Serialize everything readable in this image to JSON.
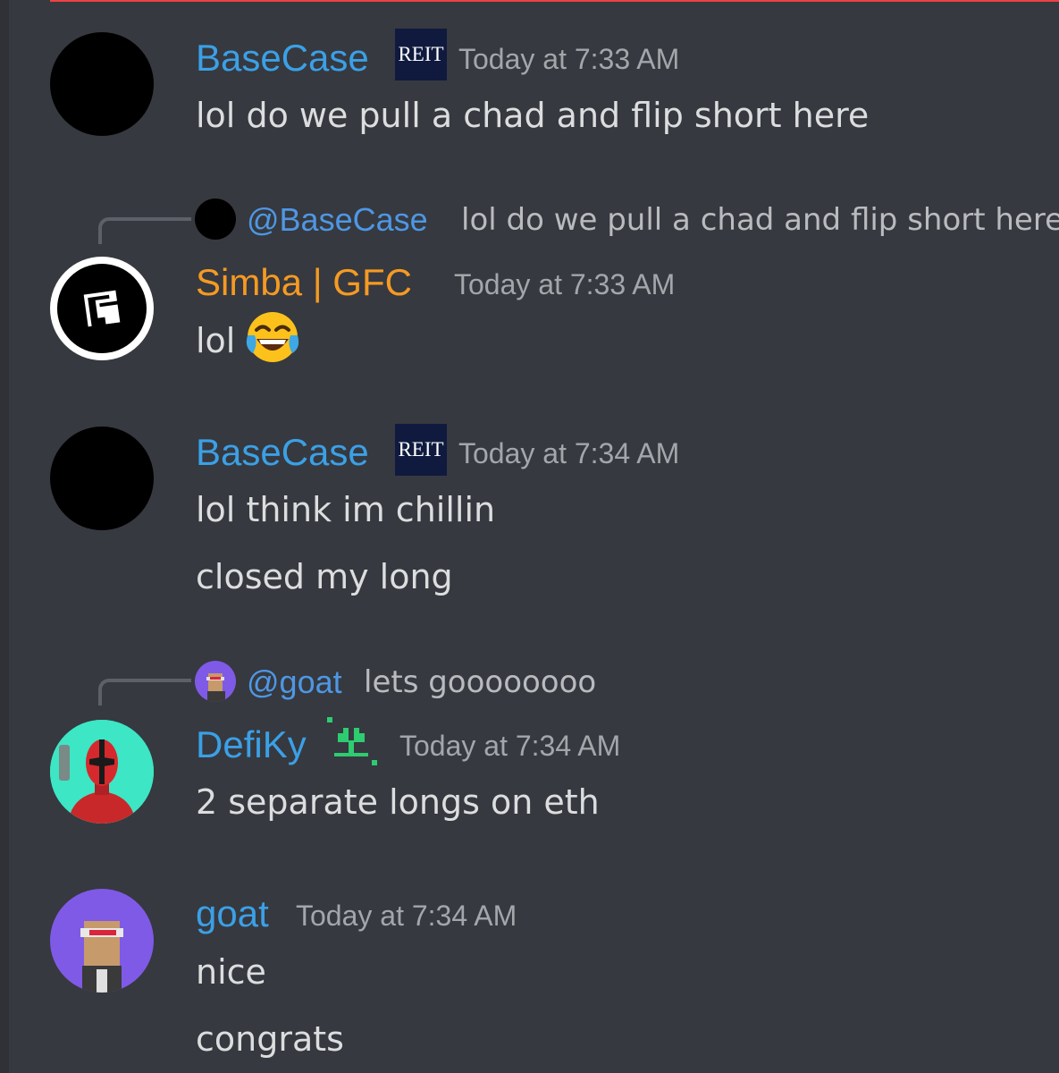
{
  "colors": {
    "background": "#36393f",
    "username_blue": "#3ba0e6",
    "username_orange": "#f59a23",
    "mention": "#4e97e4",
    "message_text": "#dcddde",
    "timestamp": "#a3a6aa"
  },
  "messages": [
    {
      "author": "BaseCase",
      "badge": "REIT",
      "timestamp": "Today at 7:33 AM",
      "lines": [
        "lol do we pull a chad and flip short here"
      ]
    },
    {
      "reply": {
        "mention": "@BaseCase",
        "text": "lol do we pull a chad and flip short here"
      },
      "author": "Simba | GFC",
      "timestamp": "Today at 7:33 AM",
      "lines": [
        "lol"
      ],
      "emoji": "joy-emoji"
    },
    {
      "author": "BaseCase",
      "badge": "REIT",
      "timestamp": "Today at 7:34 AM",
      "lines": [
        "lol think im chillin",
        "closed my long"
      ]
    },
    {
      "reply": {
        "mention": "@goat",
        "text": "lets goooooooo"
      },
      "author": "DefiKy",
      "badge_icon": "seedling-icon",
      "timestamp": "Today at 7:34 AM",
      "lines": [
        "2 separate longs on eth"
      ]
    },
    {
      "author": "goat",
      "timestamp": "Today at 7:34 AM",
      "lines": [
        "nice",
        "congrats"
      ]
    }
  ]
}
